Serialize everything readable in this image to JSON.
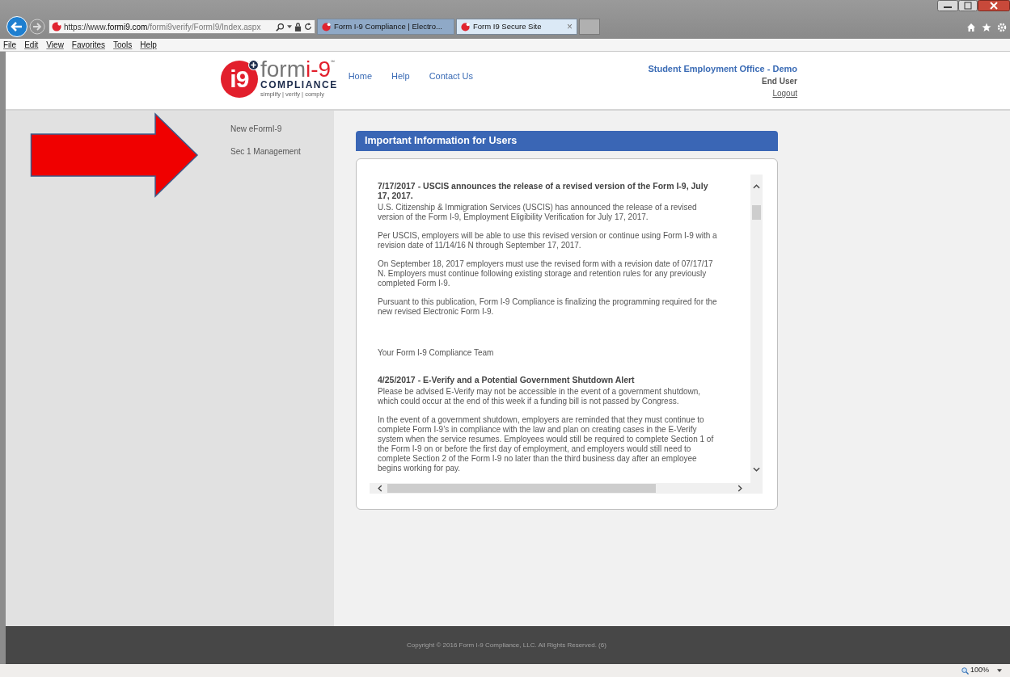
{
  "browser": {
    "address": {
      "scheme": "https://www.",
      "domain": "formi9.com",
      "path": "/formi9verify/FormI9/Index.aspx"
    },
    "tabs": [
      {
        "title": "Form I-9 Compliance | Electro...",
        "selected": false
      },
      {
        "title": "Form I9 Secure Site",
        "selected": true,
        "close": "×"
      }
    ],
    "menu": [
      "File",
      "Edit",
      "View",
      "Favorites",
      "Tools",
      "Help"
    ]
  },
  "header": {
    "logo": {
      "badge": "i9",
      "word": "form",
      "mark": "i-9",
      "service_mark": "℠",
      "company": "COMPLIANCE",
      "tagline": "simplify | verify | comply"
    },
    "nav": [
      "Home",
      "Help",
      "Contact Us"
    ],
    "organization": "Student Employment Office - Demo",
    "role": "End User",
    "logout": "Logout"
  },
  "sidebar": {
    "items": [
      "New eFormI-9",
      "Sec 1 Management"
    ]
  },
  "panel": {
    "title": "Important Information for Users",
    "news": [
      {
        "kind": "heading",
        "text": "7/17/2017 - USCIS announces the release of a revised version of the Form I-9, July 17, 2017."
      },
      {
        "kind": "paragraph",
        "text": "U.S. Citizenship & Immigration Services (USCIS) has announced the release of a revised version of the Form I-9, Employment Eligibility Verification for July 17, 2017."
      },
      {
        "kind": "paragraph",
        "text": "Per USCIS, employers will be able to use this revised version or continue using Form I-9 with a revision date of 11/14/16 N through September 17, 2017."
      },
      {
        "kind": "paragraph",
        "text": "On September 18, 2017 employers must use the revised form with a revision date of 07/17/17 N. Employers must continue following existing storage and retention rules for any previously completed Form I-9."
      },
      {
        "kind": "paragraph",
        "text": "Pursuant to this publication, Form I-9 Compliance is finalizing the programming required for the new revised Electronic Form I-9."
      },
      {
        "kind": "signature",
        "text": "Your Form I-9 Compliance Team"
      },
      {
        "kind": "heading",
        "text": "4/25/2017 - E-Verify and a Potential Government Shutdown Alert"
      },
      {
        "kind": "paragraph",
        "text": "Please be advised E-Verify may not be accessible in the event of a government shutdown, which could occur at the end of this week if a funding bill is not passed by Congress."
      },
      {
        "kind": "paragraph",
        "text": "In the event of a government shutdown, employers are reminded that they must continue to complete Form I-9’s in compliance with the law and plan on creating cases in the E-Verify system when the service resumes. Employees would still be required to complete Section 1 of the Form I-9 on or before the first day of employment, and employers would still need to complete Section 2 of the Form I-9 no later than the third business day after an employee begins working for pay."
      }
    ]
  },
  "footer": "Copyright © 2016 Form I-9 Compliance, LLC. All Rights Reserved. (6)",
  "status_bar": {
    "zoom": "100%"
  }
}
